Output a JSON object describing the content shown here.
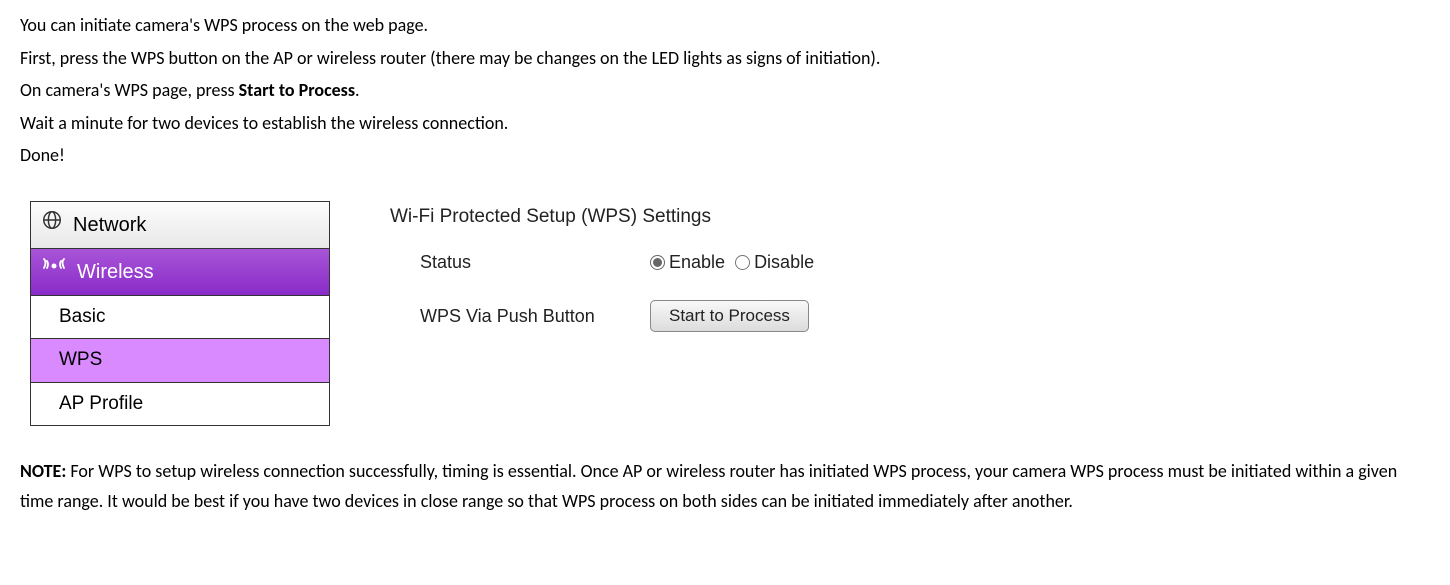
{
  "instructions": {
    "line1": "You can initiate camera's WPS process on the web page.",
    "line2": "First, press the WPS button on the AP or wireless router (there may be changes on the LED lights as signs of initiation).",
    "line3_prefix": "On camera's WPS page, press ",
    "line3_bold": "Start to Process",
    "line3_suffix": ".",
    "line4": "Wait a minute for two devices to establish the wireless connection.",
    "line5": "Done!"
  },
  "sidebar": {
    "network": "Network",
    "wireless": "Wireless",
    "basic": "Basic",
    "wps": "WPS",
    "ap_profile": "AP Profile"
  },
  "panel": {
    "title": "Wi-Fi Protected Setup (WPS) Settings",
    "status_label": "Status",
    "enable": "Enable",
    "disable": "Disable",
    "push_label": "WPS Via Push Button",
    "button": "Start to Process"
  },
  "note": {
    "label": "NOTE:",
    "text": " For WPS to setup wireless connection successfully, timing is essential. Once AP or wireless router has initiated WPS process, your camera WPS process must be initiated within a given time range. It would be best if you have two devices in close range so that WPS process on both sides can be initiated immediately after another."
  }
}
